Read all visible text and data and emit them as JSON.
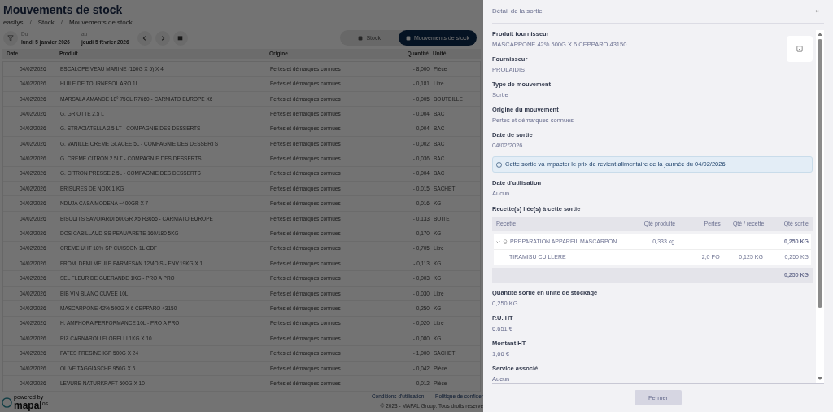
{
  "page": {
    "title": "Mouvements de stock",
    "breadcrumb": [
      "easilys",
      "Stock",
      "Mouvements de stock"
    ],
    "breadcrumb_separator": "/"
  },
  "filters": {
    "from_label": "Du",
    "from_value": "lundi 5 janvier 2026",
    "to_label": "au",
    "to_value": "jeudi 5 février 2026"
  },
  "view_tabs": [
    {
      "label": "Stock",
      "selected": false
    },
    {
      "label": "Mouvements de stock",
      "selected": true
    }
  ],
  "table": {
    "columns": [
      "Date",
      "Produit",
      "Origine",
      "Quantité",
      "Unité"
    ],
    "rows": [
      [
        "04/02/2026",
        "ESCALOPE VEAU MARINE (160G X 5) X 4",
        "Pertes et démarques connues",
        "- 8,000",
        "Pièce"
      ],
      [
        "04/02/2026",
        "HUILE DE TOURNESOL ARO 1L",
        "Pertes et démarques connues",
        "- 0,181",
        "Litre"
      ],
      [
        "04/02/2026",
        "MARSALA AMANDE 18° 75CL R7660 - CARNIATO EUROPE X6",
        "Pertes et démarques connues",
        "- 0,005",
        "BOUTEILLE"
      ],
      [
        "04/02/2026",
        "G. GRIOTTE 2.5 L",
        "Pertes et démarques connues",
        "- 0,004",
        "BAC"
      ],
      [
        "04/02/2026",
        "G. STRACIATELLA 2.5 LT - COMPAGNIE DES DESSERTS",
        "Pertes et démarques connues",
        "- 0,004",
        "BAC"
      ],
      [
        "04/02/2026",
        "G. VANILLE CREME GLACEE 5L - COMPAGNIE DES DESSERTS",
        "Pertes et démarques connues",
        "- 0,002",
        "BAC"
      ],
      [
        "04/02/2026",
        "G. CREME CITRON 2.5LT - COMPAGNIE DES DESSERTS",
        "Pertes et démarques connues",
        "- 0,036",
        "BAC"
      ],
      [
        "04/02/2026",
        "G. CITRON PRESSE 2.5L - COMPAGNIE DES DESSERTS",
        "Pertes et démarques connues",
        "- 0,004",
        "BAC"
      ],
      [
        "04/02/2026",
        "BRISURES DE NOIX 1 KG",
        "Pertes et démarques connues",
        "- 0,015",
        "SACHET"
      ],
      [
        "04/02/2026",
        "NDUJA CASA MODENA ~400GR X 7",
        "Pertes et démarques connues",
        "- 0,016",
        "KG"
      ],
      [
        "04/02/2026",
        "BISCUITS SAVOIARDI 500GR X5 R3655 - CARNIATO EUROPE",
        "Pertes et démarques connues",
        "- 0,133",
        "BOITE"
      ],
      [
        "04/02/2026",
        "DOS CABILLAUD SS PEAU/ARETE 160/180 5KG",
        "Pertes et démarques connues",
        "- 0,170",
        "KG"
      ],
      [
        "04/02/2026",
        "CREME UHT 18% SP CUISSON 1L CDF",
        "Pertes et démarques connues",
        "- 0,705",
        "Litre"
      ],
      [
        "04/02/2026",
        "FROM. DEMI MEULE PARMESAN 12MOIS - ENV.19KG X 1",
        "Pertes et démarques connues",
        "- 0,113",
        "KG"
      ],
      [
        "04/02/2026",
        "SEL FLEUR DE GUERANDE 1KG - PRO A PRO",
        "Pertes et démarques connues",
        "- 0,003",
        "KG"
      ],
      [
        "04/02/2026",
        "BIB VIN BLANC CUVEE 10L",
        "Pertes et démarques connues",
        "- 0,030",
        "Litre"
      ],
      [
        "04/02/2026",
        "MASCARPONE 42% 500G X 6 CEPPARO 43150",
        "Pertes et démarques connues",
        "- 0,250",
        "KG"
      ],
      [
        "04/02/2026",
        "H. AMPHORA PERFORMANCE 10L - PRO A PRO",
        "Pertes et démarques connues",
        "- 0,020",
        "Litre"
      ],
      [
        "04/02/2026",
        "RIZ CARNAROLI FLORELLI 1KG X 10",
        "Pertes et démarques connues",
        "- 0,080",
        "KG"
      ],
      [
        "04/02/2026",
        "PATES FRESINE IGP 500G X 24",
        "Pertes et démarques connues",
        "- 1,000",
        "SACHET"
      ],
      [
        "04/02/2026",
        "OLIVE TAGGIASCHE 950G X 6",
        "Pertes et démarques connues",
        "- 0,042",
        "Pièce"
      ],
      [
        "04/02/2026",
        "LEVURE NATURKRAFT 500G X 10",
        "Pertes et démarques connues",
        "- 0,012",
        "Pièce"
      ]
    ]
  },
  "footer": {
    "powered_by": "powered by",
    "logo": "mapal",
    "logo_suffix": "os",
    "links": [
      "Conditions d'utilisation",
      "Politique de confider"
    ],
    "link_separator": "|",
    "copyright": "© 2023 - MAPAL Group. Tous droits réserve"
  },
  "drawer": {
    "title": "Détail de la sortie",
    "close": "×",
    "fields_top": [
      {
        "label": "Produit fournisseur",
        "value": "MASCARPONE 42% 500G X 6 CEPPARO 43150"
      },
      {
        "label": "Fournisseur",
        "value": "PROLAIDIS"
      },
      {
        "label": "Type de mouvement",
        "value": "Sortie"
      },
      {
        "label": "Origine du mouvement",
        "value": "Pertes et démarques connues"
      },
      {
        "label": "Date de sortie",
        "value": "04/02/2026"
      }
    ],
    "info": "Cette sortie va impacter le prix de revient alimentaire de la journée du 04/02/2026",
    "fields_mid": [
      {
        "label": "Date d'utilisation",
        "value": "Aucun"
      }
    ],
    "recipes_label": "Recette(s) liée(s) à cette sortie",
    "recipes": {
      "columns": [
        "Recette",
        "Qté produite",
        "Pertes",
        "Qté / recette",
        "Qté sortie"
      ],
      "rows": [
        {
          "name": "PREPARATION APPAREIL MASCARPON",
          "produced": "0,333 kg",
          "out": "0,250 KG",
          "expanded": true,
          "children": [
            {
              "name": "TIRAMISU CUILLERE",
              "losses": "2,0 PO",
              "per_recipe": "0,125 KG",
              "out": "0,250 KG"
            }
          ]
        }
      ],
      "total": "0,250 KG"
    },
    "fields_bottom": [
      {
        "label": "Quantité sortie en unité de stockage",
        "value": "0,250 KG"
      },
      {
        "label": "P.U. HT",
        "value": "6,651 €"
      },
      {
        "label": "Montant HT",
        "value": "1,66 €"
      },
      {
        "label": "Service associé",
        "value": "Aucun"
      }
    ],
    "button": "Fermer"
  }
}
